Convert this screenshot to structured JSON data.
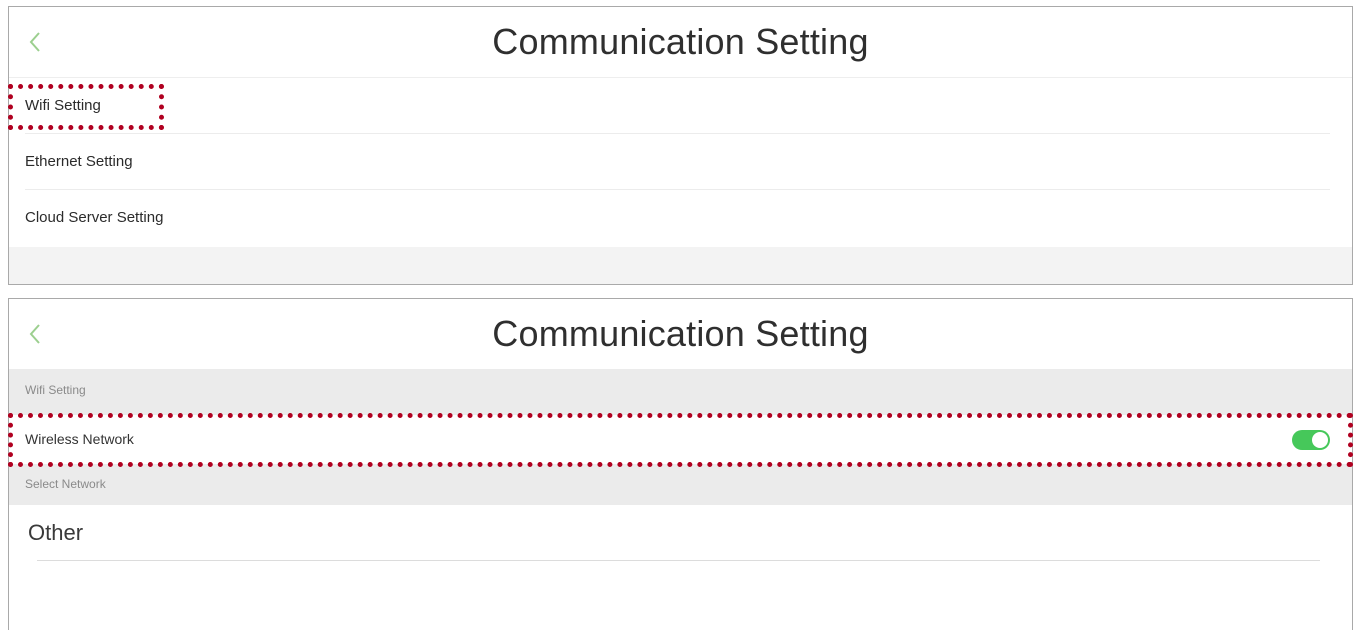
{
  "screen_top": {
    "title": "Communication Setting",
    "back_icon": "chevron-left-icon",
    "menu_items": [
      {
        "label": "Wifi Setting"
      },
      {
        "label": "Ethernet Setting"
      },
      {
        "label": "Cloud Server Setting"
      }
    ]
  },
  "screen_bottom": {
    "title": "Communication Setting",
    "back_icon": "chevron-left-icon",
    "wifi_section_header": "Wifi Setting",
    "wireless_network": {
      "label": "Wireless Network",
      "enabled": true
    },
    "select_network_header": "Select Network",
    "networks": [
      {
        "label": "Other"
      }
    ]
  },
  "colors": {
    "accent_green": "#46c85a",
    "back_chevron": "#9ccf8f",
    "highlight_red": "#b00020",
    "section_gray": "#ebebeb"
  }
}
